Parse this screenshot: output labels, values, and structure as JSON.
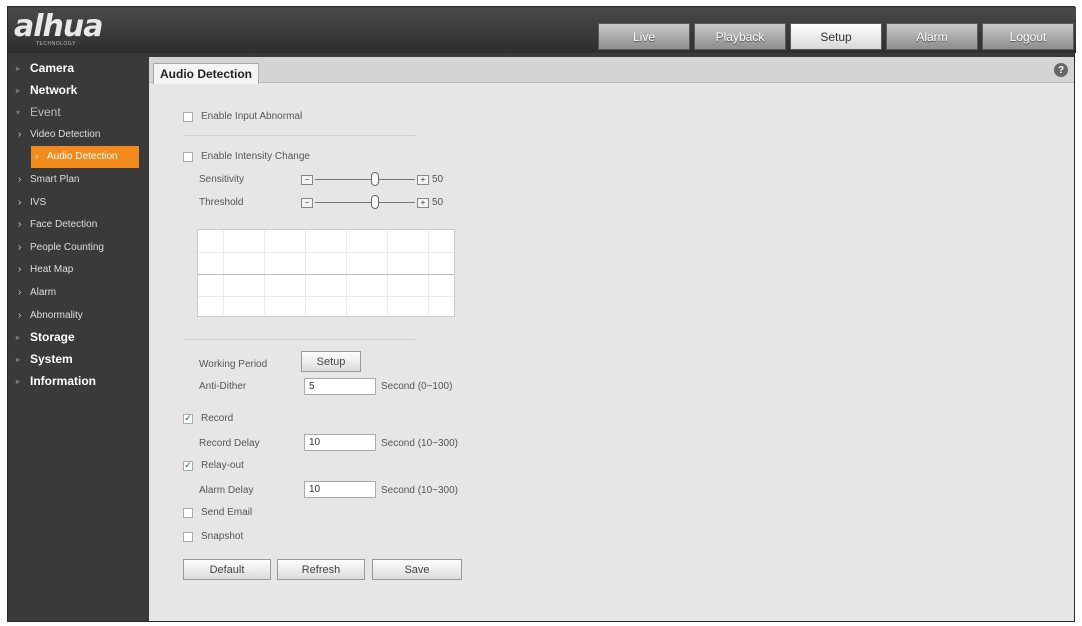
{
  "header": {
    "logo_text": "alhua",
    "logo_sub": "TECHNOLOGY",
    "tabs": [
      "Live",
      "Playback",
      "Setup",
      "Alarm",
      "Logout"
    ],
    "active_tab": "Setup"
  },
  "sidebar": {
    "camera": "Camera",
    "network": "Network",
    "event": "Event",
    "event_items": [
      "Video Detection",
      "Audio Detection",
      "Smart Plan",
      "IVS",
      "Face Detection",
      "People Counting",
      "Heat Map",
      "Alarm",
      "Abnormality"
    ],
    "active_item": "Audio Detection",
    "storage": "Storage",
    "system": "System",
    "information": "Information"
  },
  "content": {
    "page_tab": "Audio Detection",
    "help_icon": "?",
    "enable_input_abnormal": {
      "label": "Enable Input Abnormal",
      "checked": false
    },
    "enable_intensity_change": {
      "label": "Enable Intensity Change",
      "checked": false
    },
    "sensitivity": {
      "label": "Sensitivity",
      "value": "50"
    },
    "threshold": {
      "label": "Threshold",
      "value": "50"
    },
    "working_period": {
      "label": "Working Period",
      "button": "Setup"
    },
    "anti_dither": {
      "label": "Anti-Dither",
      "value": "5",
      "unit": "Second (0~100)"
    },
    "record": {
      "label": "Record",
      "checked": true
    },
    "record_delay": {
      "label": "Record Delay",
      "value": "10",
      "unit": "Second (10~300)"
    },
    "relay_out": {
      "label": "Relay-out",
      "checked": true
    },
    "alarm_delay": {
      "label": "Alarm Delay",
      "value": "10",
      "unit": "Second (10~300)"
    },
    "send_email": {
      "label": "Send Email",
      "checked": false
    },
    "snapshot": {
      "label": "Snapshot",
      "checked": false
    },
    "buttons": {
      "default": "Default",
      "refresh": "Refresh",
      "save": "Save"
    }
  }
}
